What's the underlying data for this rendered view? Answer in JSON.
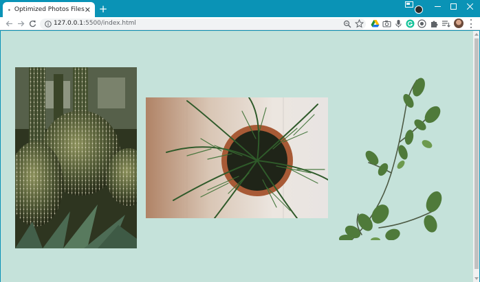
{
  "browser": {
    "tab_title": "Optimized Photos Files",
    "url_host": "127.0.0.1",
    "url_rest": ":5500/index.html",
    "window_controls": [
      "minimize",
      "maximize",
      "close"
    ]
  },
  "page": {
    "background": "#c5e2da",
    "images": [
      {
        "name": "barrel-cactus-photo",
        "alt": "Barrel cactus plants"
      },
      {
        "name": "potted-palm-photo",
        "alt": "Potted palm seen from above"
      },
      {
        "name": "green-branch-photo",
        "alt": "Branch with green leaves"
      }
    ]
  },
  "colors": {
    "titlebar": "#0a93b6",
    "page_bg": "#c5e2da"
  }
}
